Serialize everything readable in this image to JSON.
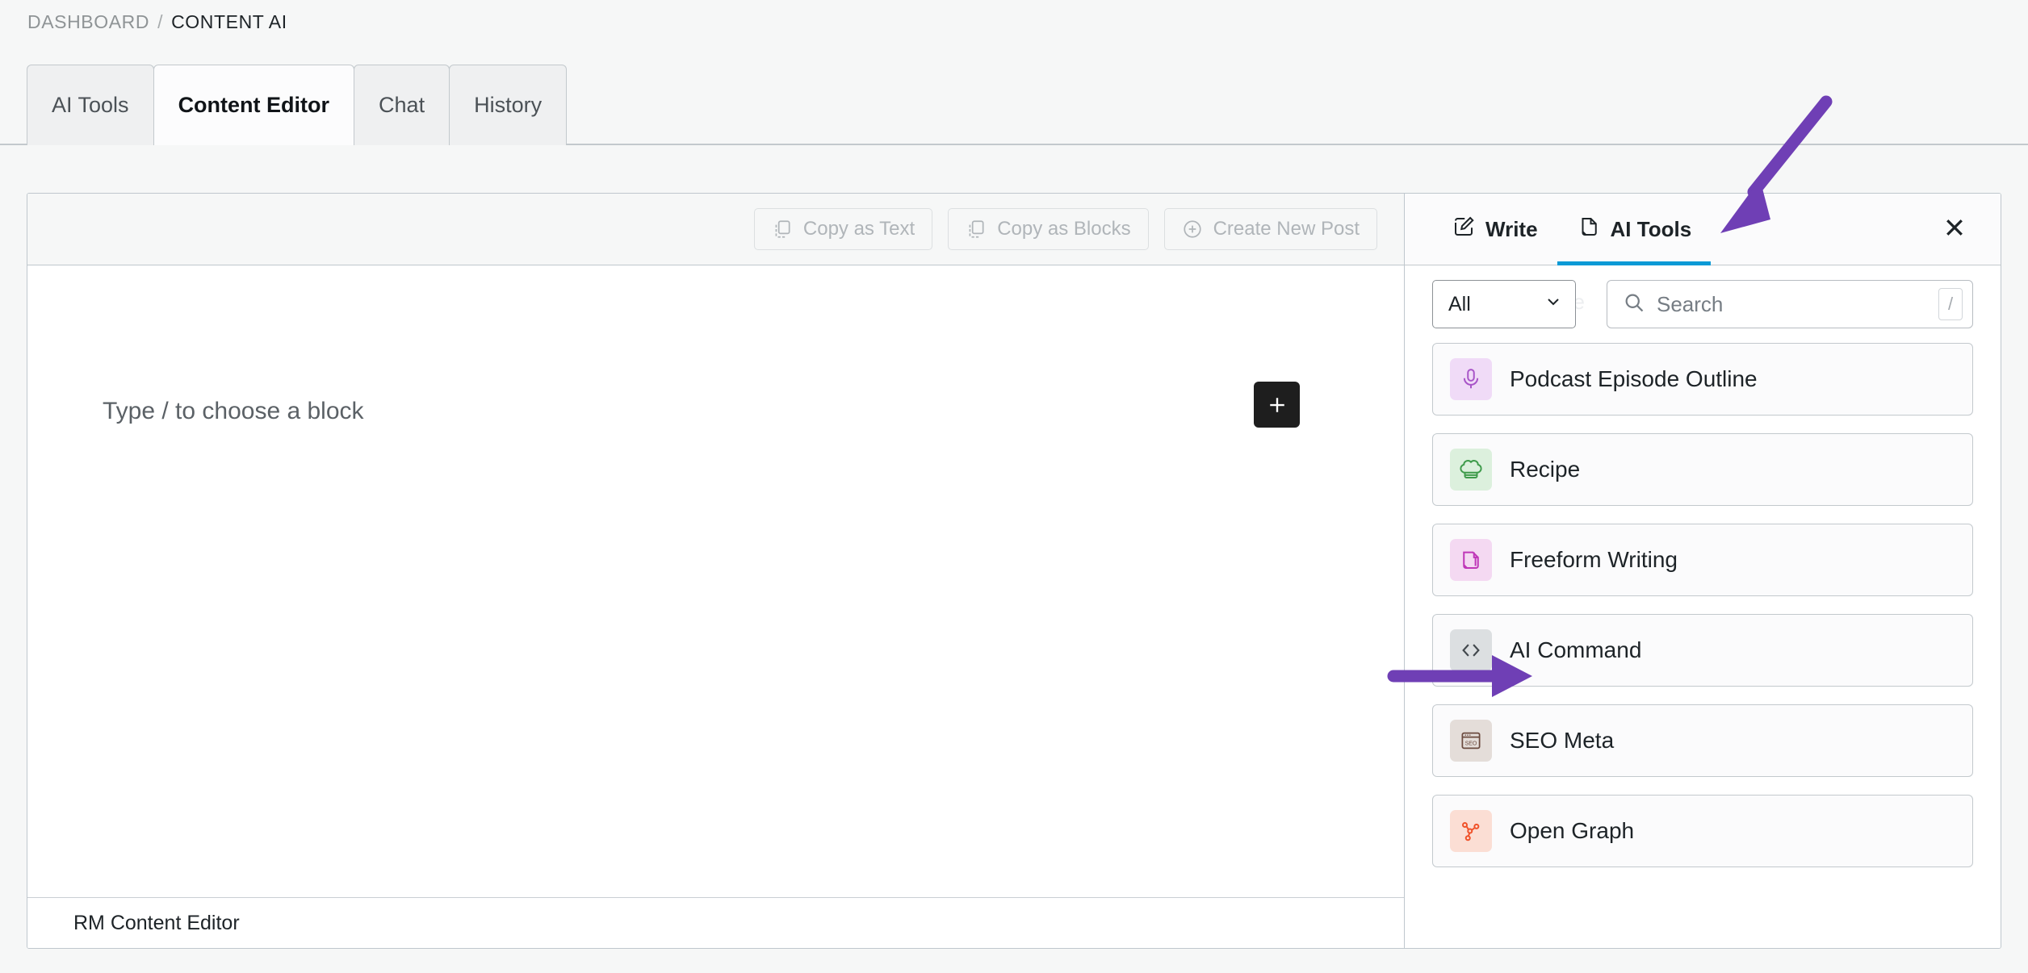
{
  "breadcrumb": {
    "root": "DASHBOARD",
    "separator": "/",
    "current": "CONTENT AI"
  },
  "tabs": [
    {
      "label": "AI Tools",
      "active": false
    },
    {
      "label": "Content Editor",
      "active": true
    },
    {
      "label": "Chat",
      "active": false
    },
    {
      "label": "History",
      "active": false
    }
  ],
  "editor": {
    "toolbar": {
      "copy_as_text": "Copy as Text",
      "copy_as_blocks": "Copy as Blocks",
      "create_new_post": "Create New Post"
    },
    "placeholder": "Type / to choose a block",
    "add_block_label": "+",
    "footer_label": "RM Content Editor"
  },
  "ai_panel": {
    "tabs": [
      {
        "label": "Write",
        "icon": "write-icon",
        "active": false
      },
      {
        "label": "AI Tools",
        "icon": "ai-tools-icon",
        "active": true
      }
    ],
    "close_label": "✕",
    "filter": {
      "value": "All",
      "caret": "chevron-down-icon"
    },
    "search": {
      "value": "",
      "placeholder": "Search",
      "shortcut": "/"
    },
    "ghost_text": "be",
    "tools": [
      {
        "label": "Podcast Episode Outline",
        "icon": "microphone-icon",
        "icon_color": "#a855c8",
        "icon_bg": "#f0dbf7"
      },
      {
        "label": "Recipe",
        "icon": "chef-hat-icon",
        "icon_color": "#3f9b4b",
        "icon_bg": "#dcf0dd"
      },
      {
        "label": "Freeform Writing",
        "icon": "document-pen-icon",
        "icon_color": "#bf37b8",
        "icon_bg": "#f4d9f2"
      },
      {
        "label": "AI Command",
        "icon": "code-icon",
        "icon_color": "#42484d",
        "icon_bg": "#dcdfe1"
      },
      {
        "label": "SEO Meta",
        "icon": "seo-window-icon",
        "icon_color": "#6b4a3f",
        "icon_bg": "#e4ddd9"
      },
      {
        "label": "Open Graph",
        "icon": "share-nodes-icon",
        "icon_color": "#f0522a",
        "icon_bg": "#fbded4"
      }
    ]
  },
  "annotations": {
    "accent_color": "#6f3fb5",
    "arrows": [
      {
        "name": "arrow-to-ai-tools-tab",
        "direction": "down-left"
      },
      {
        "name": "arrow-to-ai-command-tool",
        "direction": "right"
      }
    ]
  },
  "colors": {
    "tab_active_underline": "#0b9ad6",
    "page_background": "#f6f7f7",
    "card_border": "#bfc7cd"
  }
}
